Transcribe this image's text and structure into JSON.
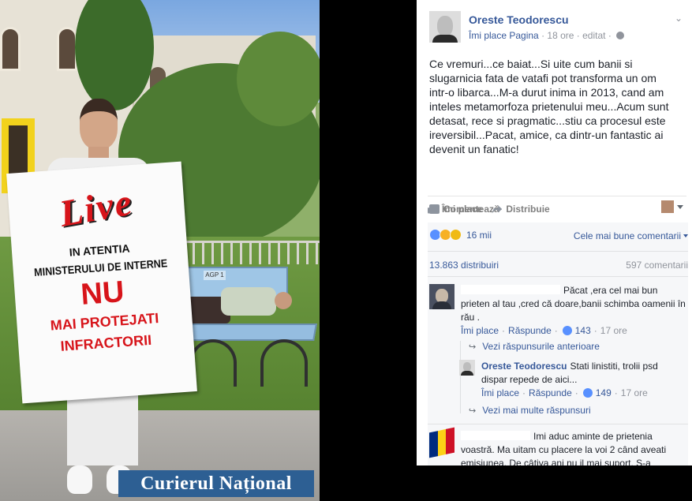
{
  "photo": {
    "sign_lines": [
      "Live",
      "IN ATENTIA",
      "MINISTERULUI DE INTERNE",
      "NU",
      "MAI PROTEJATI",
      "INFRACTORII"
    ],
    "bench_tag": "AGP 1",
    "watermark": "Curierul Național"
  },
  "post": {
    "author": "Oreste Teodorescu",
    "like_page": "Îmi place Pagina",
    "time": "18 ore",
    "edited": "editat",
    "text": "Ce vremuri...ce baiat...Si uite cum banii si slugarnicia fata de vatafi pot transforma un om intr-o libarca...M-a durut inima in 2013, cand am inteles metamorfoza prietenului meu...Acum sunt detasat, rece si pragmatic...stiu ca procesul este ireversibil...Pacat, amice, ca dintr-un fantastic ai devenit un fanatic!"
  },
  "actions": {
    "like": "Îmi place",
    "comment": "Comentează",
    "share": "Distribuie"
  },
  "stats": {
    "reactions": "16 mii",
    "sort": "Cele mai bune comentarii",
    "shares": "13.863 distribuiri",
    "comments": "597 comentarii"
  },
  "comments": [
    {
      "text": "Păcat ,era cel mai bun prieten al tau ,cred că doare,banii schimba oamenii în rău .",
      "like": "Îmi place",
      "reply": "Răspunde",
      "likes": "143",
      "time": "17 ore",
      "previous_replies": "Vezi răspunsurile anterioare",
      "reply_item": {
        "author": "Oreste Teodorescu",
        "text": "Stati linistiti, trolii psd dispar repede de aici...",
        "like": "Îmi place",
        "reply": "Răspunde",
        "likes": "149",
        "time": "17 ore"
      },
      "more_replies": "Vezi mai multe răspunsuri"
    },
    {
      "text": "Imi aduc aminte de prietenia voastră. Ma uitam cu placere la voi 2 când aveati emisiunea. De câtiva ani nu il mai suport. S-a"
    }
  ],
  "colors": {
    "link": "#365899",
    "muted": "#90949c",
    "reaction_like": "#5890ff",
    "flag_blue": "#002b7f",
    "flag_yellow": "#fcd116",
    "flag_red": "#ce1126"
  }
}
